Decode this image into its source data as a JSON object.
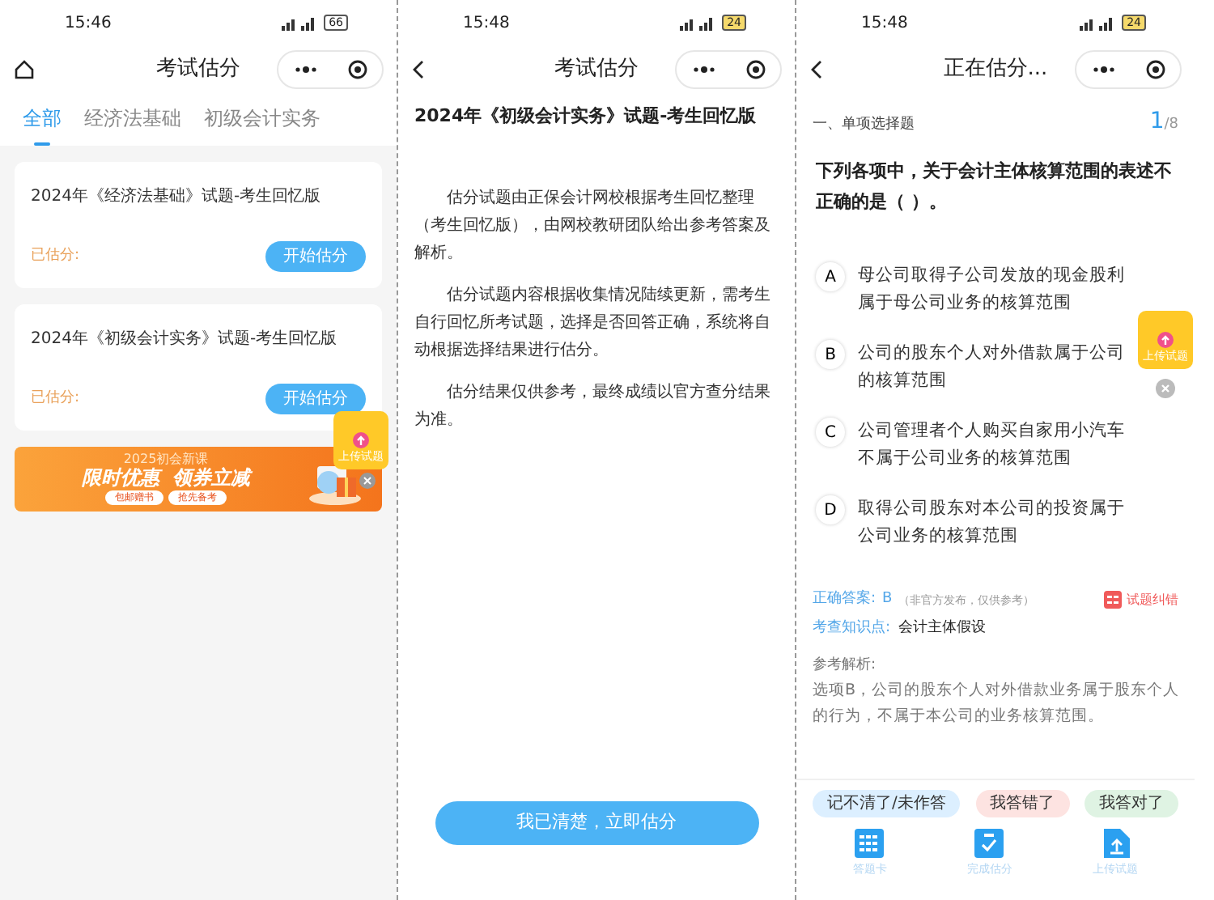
{
  "screens": [
    {
      "kind": "list",
      "status": {
        "time": "15:46",
        "battery": "66"
      },
      "nav": {
        "title": "考试估分"
      },
      "tabs": [
        {
          "label": "全部",
          "selected": true
        },
        {
          "label": "经济法基础",
          "selected": false
        },
        {
          "label": "初级会计实务",
          "selected": false
        }
      ],
      "cards": [
        {
          "title": "2024年《经济法基础》试题-考生回忆版",
          "scored_label": "已估分:",
          "button": "开始估分"
        },
        {
          "title": "2024年《初级会计实务》试题-考生回忆版",
          "scored_label": "已估分:",
          "button": "开始估分"
        }
      ],
      "banner": {
        "subtitle": "2025初会新课",
        "headline": "限时优惠  领券立减",
        "tag": "包邮赠书",
        "cta": "抢先备考"
      },
      "upload_badge": {
        "label": "上传试题"
      }
    },
    {
      "kind": "intro",
      "status": {
        "time": "15:48",
        "battery": "24"
      },
      "nav": {
        "title": "考试估分"
      },
      "heading": "2024年《初级会计实务》试题-考生回忆版",
      "paragraphs": [
        "估分试题由正保会计网校根据考生回忆整理（考生回忆版），由网校教研团队给出参考答案及解析。",
        "估分试题内容根据收集情况陆续更新，需考生自行回忆所考试题，选择是否回答正确，系统将自动根据选择结果进行估分。",
        "估分结果仅供参考，最终成绩以官方查分结果为准。"
      ],
      "button": "我已清楚，立即估分"
    },
    {
      "kind": "question",
      "status": {
        "time": "15:48",
        "battery": "24"
      },
      "nav": {
        "title": "正在估分..."
      },
      "section": "一、单项选择题",
      "progress": {
        "current": "1",
        "total": "/8"
      },
      "question": "下列各项中，关于会计主体核算范围的表述不正确的是（    ）。",
      "options": [
        {
          "letter": "A",
          "text": "母公司取得子公司发放的现金股利属于母公司业务的核算范围"
        },
        {
          "letter": "B",
          "text": "公司的股东个人对外借款属于公司的核算范围"
        },
        {
          "letter": "C",
          "text": "公司管理者个人购买自家用小汽车不属于公司业务的核算范围"
        },
        {
          "letter": "D",
          "text": "取得公司股东对本公司的投资属于公司业务的核算范围"
        }
      ],
      "answer_label": "正确答案:",
      "answer": "B",
      "answer_note": "（非官方发布，仅供参考）",
      "report": "试题纠错",
      "knowledge_label": "考查知识点:",
      "knowledge": "会计主体假设",
      "analysis_label": "参考解析:",
      "analysis": "选项B，公司的股东个人对外借款业务属于股东个人的行为，不属于本公司的业务核算范围。",
      "choices": [
        {
          "label": "记不清了/未作答",
          "color": "#dcefff"
        },
        {
          "label": "我答错了",
          "color": "#fde3e1"
        },
        {
          "label": "我答对了",
          "color": "#dff3e3"
        }
      ],
      "toolbar": [
        {
          "kind": "card",
          "label": "答题卡"
        },
        {
          "kind": "done",
          "label": "完成估分"
        },
        {
          "kind": "upload",
          "label": "上传试题"
        }
      ],
      "upload_badge": {
        "label": "上传试题"
      }
    }
  ]
}
